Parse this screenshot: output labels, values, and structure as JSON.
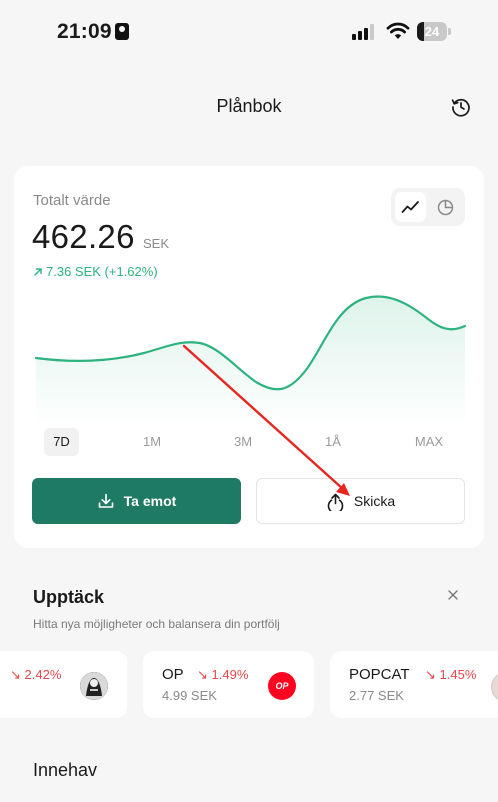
{
  "status_bar": {
    "time": "21:09",
    "battery_percent": 24,
    "battery_label": "24"
  },
  "header": {
    "title": "Plånbok"
  },
  "wallet": {
    "total_label": "Totalt värde",
    "total_value": "462.26",
    "currency": "SEK",
    "change_text": "7.36 SEK (+1.62%)",
    "accent_color": "#2db37f",
    "ranges": [
      "7D",
      "1M",
      "3M",
      "1Å",
      "MAX"
    ],
    "selected_range": "7D",
    "receive_label": "Ta emot",
    "send_label": "Skicka"
  },
  "discover": {
    "title": "Upptäck",
    "subtitle": "Hitta nya möjligheter och balansera din portfölj",
    "coins": [
      {
        "symbol": "",
        "change": "2.42%",
        "price": "",
        "logo_icon": "coin-logo-monochrome"
      },
      {
        "symbol": "OP",
        "change": "1.49%",
        "price": "4.99 SEK",
        "logo_icon": "op-logo",
        "logo_color": "#ff0420",
        "logo_text": "OP"
      },
      {
        "symbol": "POPCAT",
        "change": "1.45%",
        "price": "2.77 SEK",
        "logo_icon": "popcat-logo"
      }
    ]
  },
  "holdings": {
    "title": "Innehav"
  }
}
